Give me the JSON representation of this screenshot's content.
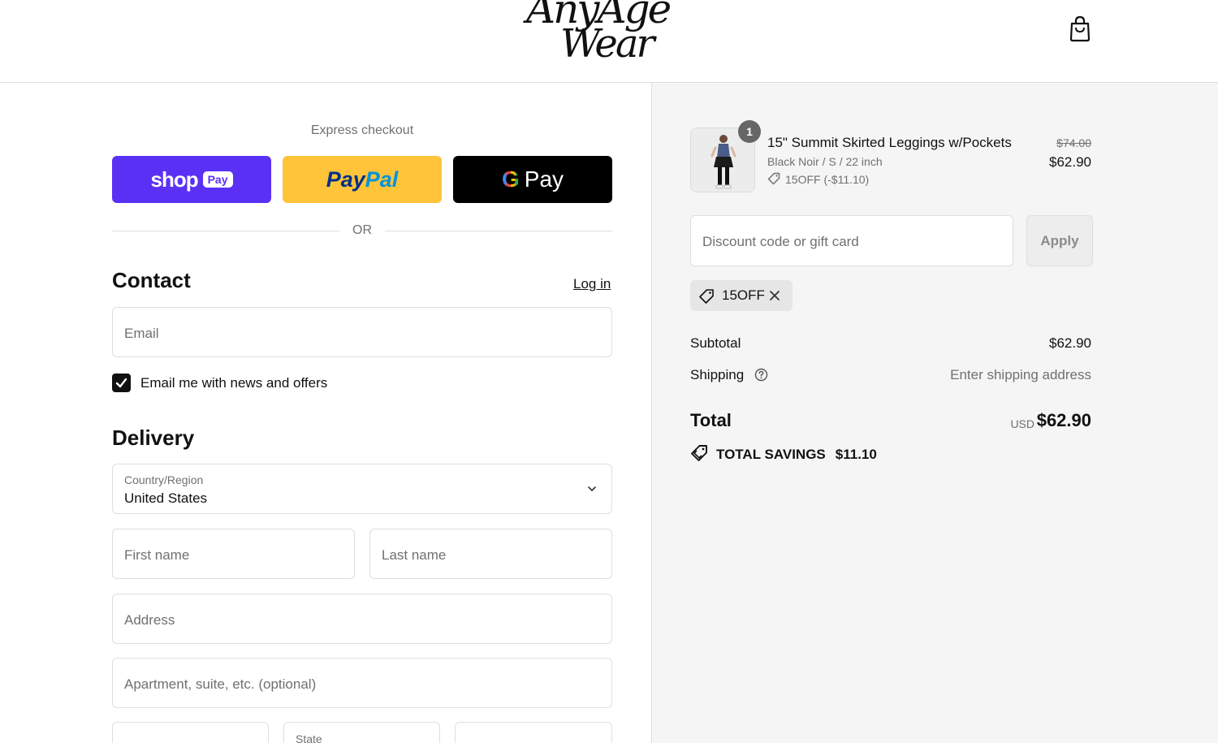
{
  "header": {
    "logo_line1": "AnyAge",
    "logo_line2": "Wear",
    "cart_icon": "shopping-bag-icon"
  },
  "express": {
    "title": "Express checkout",
    "shop_pay_word": "shop",
    "shop_pay_chip": "Pay",
    "paypal_part1": "Pay",
    "paypal_part2": "Pal",
    "gpay_g": "G",
    "gpay_pay": "Pay",
    "or": "OR"
  },
  "contact": {
    "title": "Contact",
    "login": "Log in",
    "email_placeholder": "Email",
    "newsletter_label": "Email me with news and offers",
    "newsletter_checked": true
  },
  "delivery": {
    "title": "Delivery",
    "country_label": "Country/Region",
    "country_value": "United States",
    "first_name_placeholder": "First name",
    "last_name_placeholder": "Last name",
    "address_placeholder": "Address",
    "apartment_placeholder": "Apartment, suite, etc. (optional)",
    "state_label": "State"
  },
  "summary": {
    "item": {
      "quantity": "1",
      "name": "15\" Summit Skirted Leggings w/Pockets",
      "variant": "Black Noir / S / 22 inch",
      "discount": "15OFF (-$11.10)",
      "original_price": "$74.00",
      "price": "$62.90"
    },
    "discount_placeholder": "Discount code or gift card",
    "apply_label": "Apply",
    "applied_code": "15OFF",
    "subtotal_label": "Subtotal",
    "subtotal_value": "$62.90",
    "shipping_label": "Shipping",
    "shipping_value": "Enter shipping address",
    "total_label": "Total",
    "currency": "USD",
    "total_value": "$62.90",
    "savings_label": "TOTAL SAVINGS",
    "savings_value": "$11.10"
  },
  "colors": {
    "shop_pay": "#5a31f4",
    "paypal": "#ffc439",
    "gpay": "#000000",
    "summary_bg": "#f5f5f5"
  }
}
